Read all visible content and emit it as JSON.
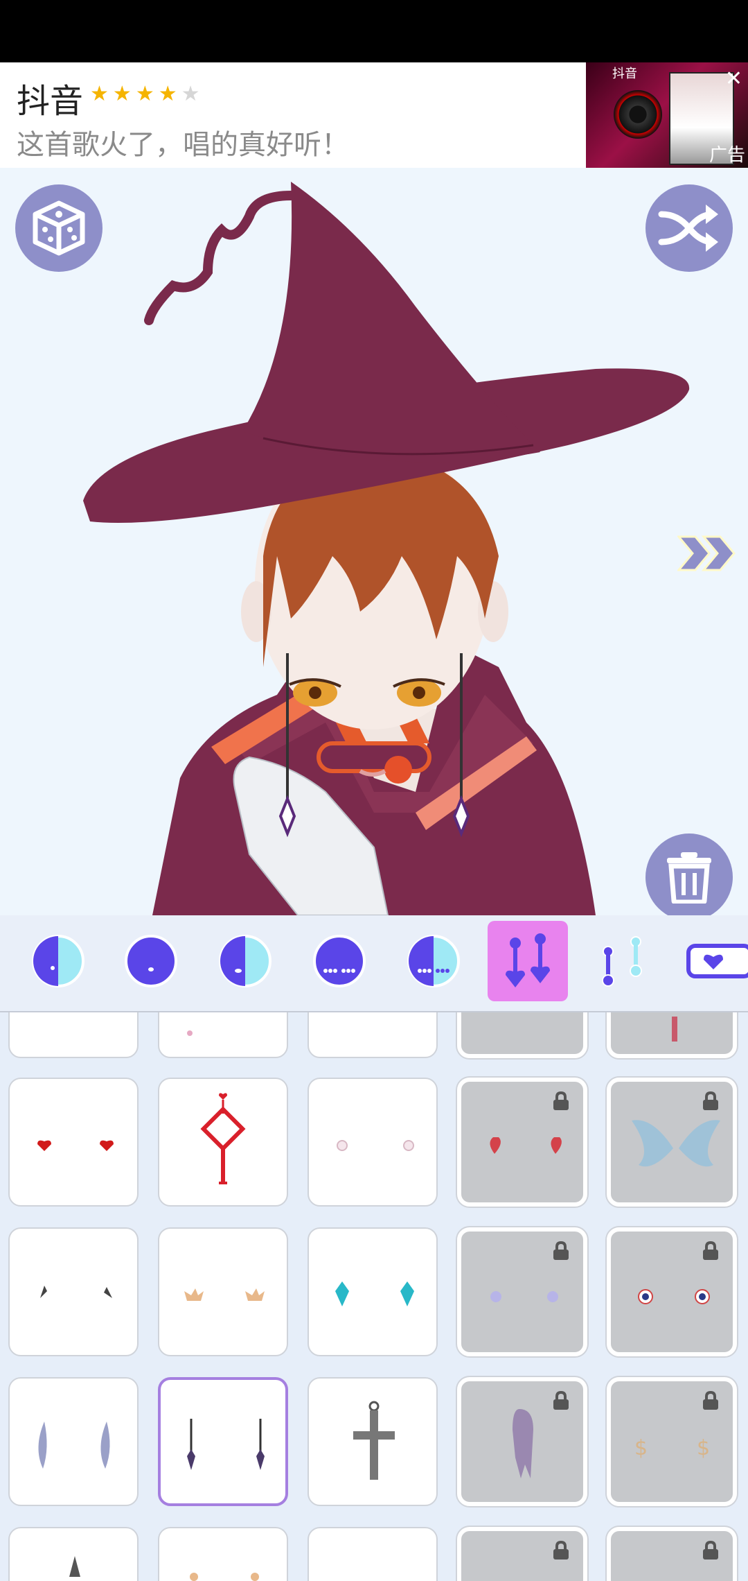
{
  "ad": {
    "app_name": "抖音",
    "rating_stars": 4,
    "description": "这首歌火了，唱的真好听！",
    "label": "广告",
    "close_symbol": "✕",
    "thumb_brand": "抖音"
  },
  "canvas": {
    "randomize_icon": "dice-icon",
    "shuffle_icon": "shuffle-icon",
    "next_icon": "double-chevron-right-icon",
    "delete_icon": "trash-icon"
  },
  "tabs": {
    "active_index": 5,
    "items": [
      "face-half",
      "face-dot",
      "face-side",
      "face-dots",
      "face-half-dots",
      "earrings-purple",
      "earrings-cyan",
      "heart-tag"
    ]
  },
  "items_grid": {
    "selected": "earring-dangle-black",
    "rows": [
      [
        "partial",
        "partial-pink",
        "partial",
        "partial-locked",
        "partial-locked-red"
      ],
      [
        "heart-studs-red",
        "red-chinese-knot",
        "pearl-studs-pink",
        "strawberry-locked",
        "butterfly-wing-locked"
      ],
      [
        "black-spike-studs",
        "gold-crown-studs",
        "cyan-crystal-drops",
        "orb-studs-locked",
        "eye-studs-locked"
      ],
      [
        "silver-feather-drops",
        "earring-dangle-black",
        "silver-cross",
        "ghost-locked",
        "dollar-studs-locked"
      ],
      [
        "dagger",
        "gold-partial",
        "empty",
        "locked",
        "locked"
      ]
    ]
  },
  "colors": {
    "accent": "#8e8fc9",
    "tab_active": "#e883ee",
    "hat": "#7a2a4b",
    "selected_border": "#a57fe0",
    "locked_bg": "#c6c8cb"
  }
}
